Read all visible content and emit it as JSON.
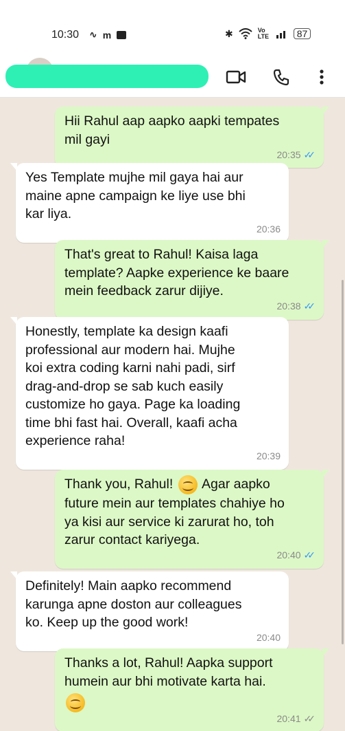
{
  "status_bar": {
    "time": "10:30",
    "left_icons": [
      "sim-icon",
      "m-icon",
      "app-icon"
    ],
    "right_icons": [
      "bluetooth-icon",
      "wifi-icon",
      "volte-icon",
      "signal-icon"
    ],
    "volte_text": "Vo LTE",
    "battery": "87"
  },
  "header": {
    "contact_name": "",
    "icons": [
      "video-call-icon",
      "voice-call-icon",
      "more-options-icon"
    ]
  },
  "colors": {
    "outgoing_bubble": "#dcf8c6",
    "incoming_bubble": "#ffffff",
    "read_ticks": "#3497f9",
    "background": "#efe7de",
    "scribble": "#2ef0b4"
  },
  "messages": [
    {
      "direction": "out",
      "text": "Hii Rahul aap aapko aapki tempates\nmil gayi",
      "time": "20:35",
      "status": "read"
    },
    {
      "direction": "in",
      "text": "Yes Template mujhe mil gaya hai aur\nmaine apne campaign ke liye use bhi\nkar liya.",
      "time": "20:36"
    },
    {
      "direction": "out",
      "text": "That's great to Rahul! Kaisa laga\ntemplate? Aapke experience ke baare\nmein feedback zarur dijiye.",
      "time": "20:38",
      "status": "read"
    },
    {
      "direction": "in",
      "text": "Honestly, template ka design kaafi\nprofessional aur modern hai. Mujhe\nkoi extra coding karni nahi padi, sirf\ndrag-and-drop se sab kuch easily\ncustomize ho gaya. Page ka loading\ntime bhi fast hai. Overall, kaafi acha\nexperience raha!",
      "time": "20:39"
    },
    {
      "direction": "out",
      "text_before_emoji": "Thank you, Rahul!",
      "text_after_emoji": "Agar aapko\nfuture mein aur templates chahiye ho\nya kisi aur service ki zarurat ho, toh\nzarur contact kariyega.",
      "emoji": "smiling-face-emoji",
      "time": "20:40",
      "status": "read"
    },
    {
      "direction": "in",
      "text": "Definitely! Main aapko recommend\nkarunga apne doston aur colleagues\nko. Keep up the good work!",
      "time": "20:40"
    },
    {
      "direction": "out",
      "text": "Thanks a lot, Rahul! Aapka support\nhumein aur bhi motivate karta hai.",
      "emoji": "smiling-face-emoji",
      "time": "20:41",
      "status": "delivered"
    }
  ]
}
